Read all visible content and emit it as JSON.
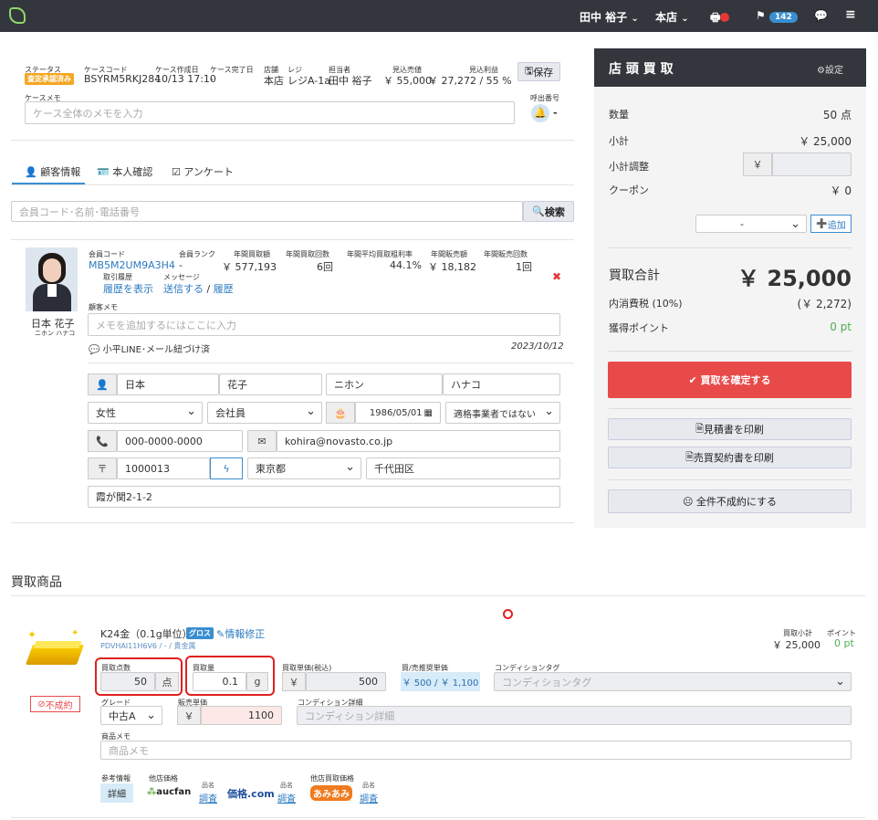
{
  "topbar": {
    "user": "田中 裕子",
    "store": "本店",
    "flag_count": "142"
  },
  "case": {
    "status_label": "ステータス",
    "status_value": "査定承認済み",
    "code_label": "ケースコード",
    "code_value": "BSYRM5RKJ284",
    "created_label": "ケース作成日",
    "created_value": "10/13 17:10",
    "finished_label": "ケース完了日",
    "finished_value": "-",
    "store_label": "店舗",
    "store_value": "本店",
    "register_label": "レジ",
    "register_value": "レジA-1a",
    "staff_label": "担当者",
    "staff_value": "田中 裕子",
    "est_sales_label": "見込売値",
    "est_sales_value": "￥ 55,000",
    "est_profit_label": "見込利益",
    "est_profit_value": "￥ 27,272 / 55 %",
    "save_label": "保存",
    "memo_label": "ケースメモ",
    "memo_placeholder": "ケース全体のメモを入力",
    "call_label": "呼出番号",
    "call_value": "-"
  },
  "tabs": [
    "顧客情報",
    "本人確認",
    "アンケート"
  ],
  "search": {
    "placeholder": "会員コード･名前･電話番号",
    "button": "検索"
  },
  "customer": {
    "name": "日本 花子",
    "kana": "ニホン ハナコ",
    "code_label": "会員コード",
    "code_value": "MB5M2UM9A3H4",
    "rank_label": "会員ランク",
    "rank_value": "-",
    "annual_amount_label": "年間買取額",
    "annual_amount_value": "￥ 577,193",
    "annual_count_label": "年間買取回数",
    "annual_count_value": "6回",
    "margin_label": "年間平均買取粗利率",
    "margin_value": "44.1%",
    "sales_amount_label": "年間販売額",
    "sales_amount_value": "￥ 18,182",
    "sales_count_label": "年間販売回数",
    "sales_count_value": "1回",
    "history_label": "取引履歴",
    "history_link": "履歴を表示",
    "message_label": "メッセージ",
    "message_send": "送信する",
    "message_sep": "/",
    "message_history": "履歴",
    "memo_label": "顧客メモ",
    "memo_placeholder": "メモを追加するにはここに入力",
    "line_text": "小平LINE･メール紐づけ済",
    "line_date": "2023/10/12",
    "last_name": "日本",
    "first_name": "花子",
    "last_kana": "ニホン",
    "first_kana": "ハナコ",
    "gender": "女性",
    "job": "会社員",
    "birthday": "1986/05/01",
    "invoice": "適格事業者ではない",
    "phone": "000-0000-0000",
    "email": "kohira@novasto.co.jp",
    "postal_mark": "〒",
    "zip": "1000013",
    "pref": "東京都",
    "city": "千代田区",
    "address": "霞が関2-1-2"
  },
  "panel": {
    "title": "店 頭 買 取",
    "settings": "設定",
    "qty_label": "数量",
    "qty_value": "50 点",
    "subtotal_label": "小計",
    "subtotal_value": "￥ 25,000",
    "adjust_label": "小計調整",
    "yen": "￥",
    "coupon_label": "クーポン",
    "coupon_value": "￥ 0",
    "coupon_select": "-",
    "add_label": "追加",
    "total_label": "買取合計",
    "total_value": "￥ 25,000",
    "tax_label": "内消費税 (10%)",
    "tax_value": "(￥ 2,272)",
    "points_label": "獲得ポイント",
    "points_value": "0 pt",
    "confirm_label": "買取を確定する",
    "estimate_label": "見積書を印刷",
    "contract_label": "売買契約書を印刷",
    "cancel_all_label": "全件不成約にする"
  },
  "items_title": "買取商品",
  "item": {
    "name": "K24金（0.1g単位）",
    "tag": "グロス",
    "edit": "情報修正",
    "code": "PDVHAI11H6V6 / - / 貴金属",
    "subtotal_label": "買取小計",
    "subtotal_value": "￥ 25,000",
    "point_label": "ポイント",
    "point_value": "0 pt",
    "cancel_label": "不成約",
    "count_label": "買取点数",
    "count_value": "50",
    "count_unit": "点",
    "weight_label": "買取量",
    "weight_value": "0.1",
    "weight_unit": "g",
    "unit_price_label": "買取単価(税込)",
    "unit_price_value": "500",
    "recommend_label": "買/売推奨単価",
    "recommend_value": "￥ 500 / ￥ 1,100",
    "condition_tag_label": "コンディションタグ",
    "condition_tag_placeholder": "コンディションタグ",
    "grade_label": "グレード",
    "grade_value": "中古A",
    "sale_price_label": "販売単価",
    "sale_price_value": "1100",
    "condition_detail_label": "コンディション詳細",
    "condition_detail_placeholder": "コンディション詳細",
    "memo_label": "商品メモ",
    "memo_placeholder": "商品メモ",
    "ref_label": "参考情報",
    "ref_button": "詳細",
    "other_price_label": "他店価格",
    "other_buy_label": "他店買取価格",
    "aucfan": "aucfan",
    "kakaku": "価格.com",
    "amiami": "あみあみ",
    "name_small": "品名",
    "survey": "調査"
  },
  "colors": {
    "accent_blue": "#3a8fd0",
    "danger": "#e84a4a",
    "dark": "#33373d",
    "status_orange": "#f5a623"
  }
}
